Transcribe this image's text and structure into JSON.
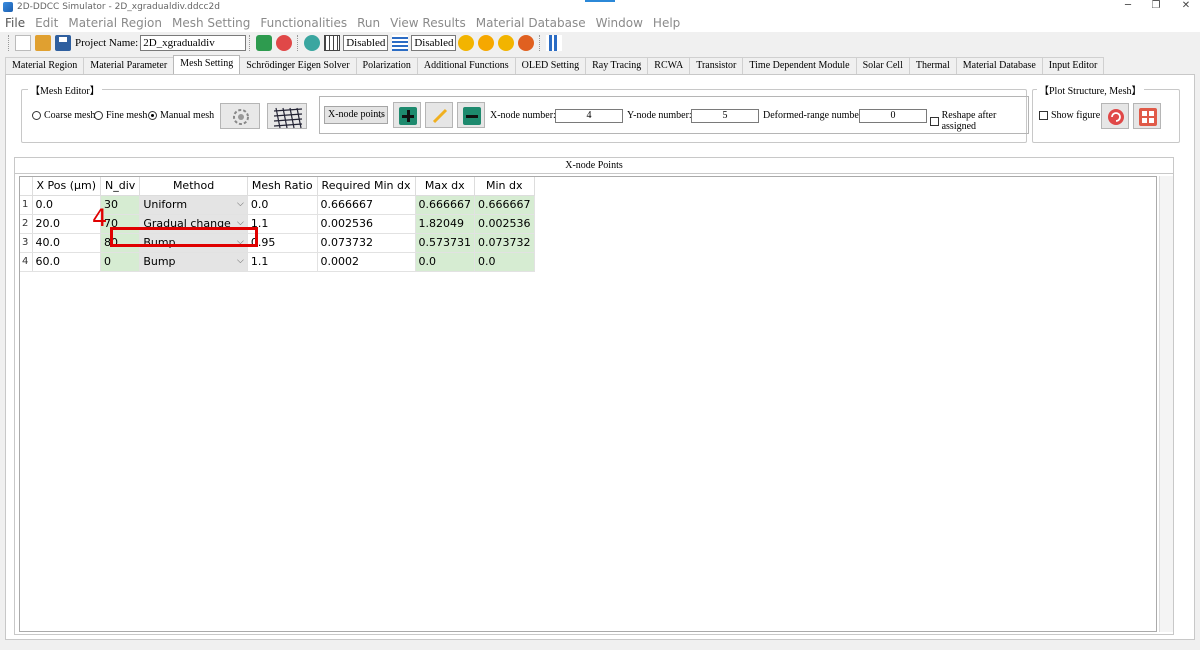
{
  "window": {
    "title": "2D-DDCC Simulator - 2D_xgradualdiv.ddcc2d",
    "controls": {
      "minimize": "─",
      "restore": "❐",
      "close": "✕"
    }
  },
  "menu": [
    "File",
    "Edit",
    "Material Region",
    "Mesh Setting",
    "Functionalities",
    "Run",
    "View Results",
    "Material Database",
    "Window",
    "Help"
  ],
  "toolbar": {
    "project_label": "Project Name:",
    "project_value": "2D_xgradualdiv",
    "status1": "Disabled",
    "status2": "Disabled"
  },
  "tabs": [
    {
      "label": "Material Region",
      "active": false
    },
    {
      "label": "Material Parameter",
      "active": false
    },
    {
      "label": "Mesh Setting",
      "active": true
    },
    {
      "label": "Schrödinger Eigen Solver",
      "active": false
    },
    {
      "label": "Polarization",
      "active": false
    },
    {
      "label": "Additional Functions",
      "active": false
    },
    {
      "label": "OLED Setting",
      "active": false
    },
    {
      "label": "Ray Tracing",
      "active": false
    },
    {
      "label": "RCWA",
      "active": false
    },
    {
      "label": "Transistor",
      "active": false
    },
    {
      "label": "Time Dependent Module",
      "active": false
    },
    {
      "label": "Solar Cell",
      "active": false
    },
    {
      "label": "Thermal",
      "active": false
    },
    {
      "label": "Material Database",
      "active": false
    },
    {
      "label": "Input Editor",
      "active": false
    }
  ],
  "mesh_editor": {
    "title": "【Mesh Editor】",
    "coarse_label": "Coarse mesh",
    "fine_label": "Fine mesh",
    "manual_label": "Manual mesh",
    "selected": "manual",
    "node_select": "X-node points",
    "x_node_label": "X-node number:",
    "x_node_value": "4",
    "y_node_label": "Y-node number:",
    "y_node_value": "5",
    "deformed_label": "Deformed-range number:",
    "deformed_value": "0",
    "reshape_label": "Reshape after assigned",
    "reshape_checked": false
  },
  "plot_structure": {
    "title": "【Plot Structure, Mesh】",
    "show_figure_label": "Show figure",
    "show_figure_checked": false
  },
  "xnode": {
    "title": "X-node Points",
    "headers": [
      "X Pos (μm)",
      "N_div",
      "Method",
      "Mesh Ratio",
      "Required Min dx",
      "Max dx",
      "Min dx"
    ],
    "rows": [
      {
        "idx": "1",
        "xpos": "0.0",
        "ndiv": "30",
        "method": "Uniform",
        "ratio": "0.0",
        "req": "0.666667",
        "maxdx": "0.666667",
        "mindx": "0.666667"
      },
      {
        "idx": "2",
        "xpos": "20.0",
        "ndiv": "70",
        "method": "Gradual change",
        "ratio": "1.1",
        "req": "0.002536",
        "maxdx": "1.82049",
        "mindx": "0.002536"
      },
      {
        "idx": "3",
        "xpos": "40.0",
        "ndiv": "80",
        "method": "Bump",
        "ratio": "0.95",
        "req": "0.073732",
        "maxdx": "0.573731",
        "mindx": "0.073732"
      },
      {
        "idx": "4",
        "xpos": "60.0",
        "ndiv": "0",
        "method": "Bump",
        "ratio": "1.1",
        "req": "0.0002",
        "maxdx": "0.0",
        "mindx": "0.0"
      }
    ]
  },
  "annotation": {
    "step": "4",
    "color": "#e00000"
  },
  "colors": {
    "green_cell": "#d6ecd2",
    "accent": "#2b88d8"
  }
}
